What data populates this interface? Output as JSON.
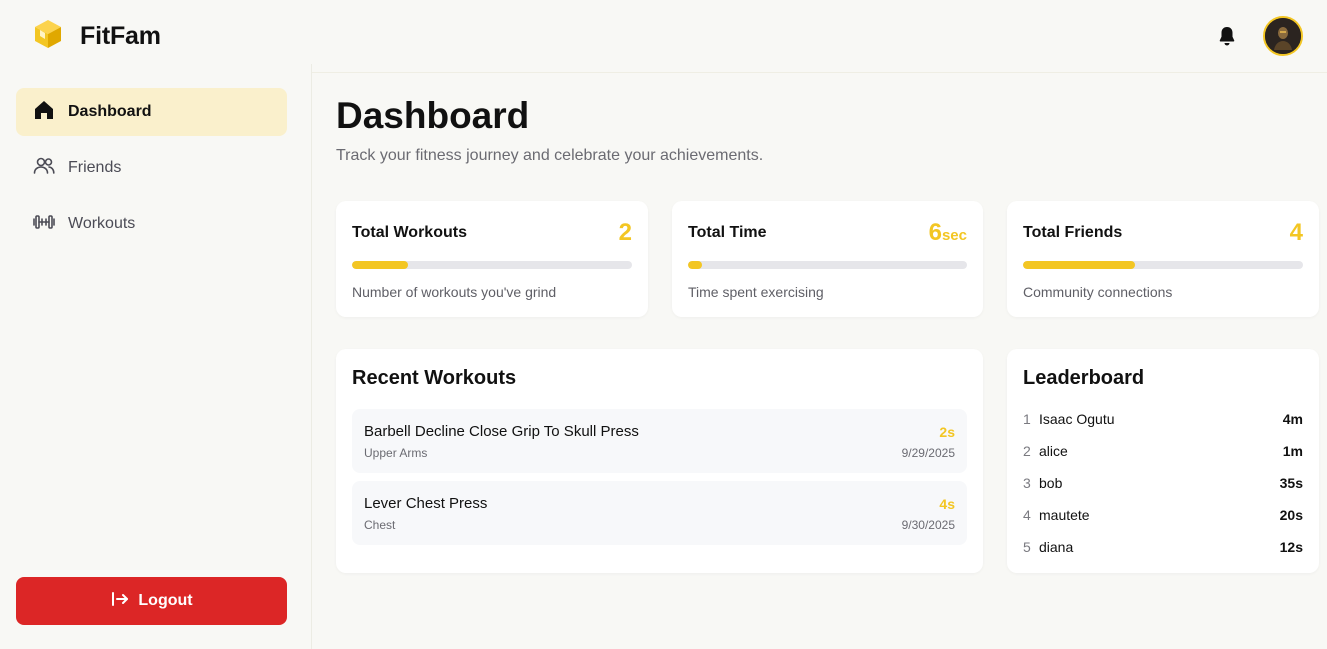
{
  "app": {
    "name": "FitFam"
  },
  "icons": {
    "brand": "cube-icon",
    "bell": "bell-icon",
    "home": "home-icon",
    "friends": "users-icon",
    "workouts": "dumbbell-icon",
    "logout": "logout-icon"
  },
  "colors": {
    "accent": "#f3c623",
    "logout": "#dc2626",
    "active_nav_bg": "#faf0cc"
  },
  "sidebar": {
    "items": [
      {
        "label": "Dashboard",
        "active": true
      },
      {
        "label": "Friends",
        "active": false
      },
      {
        "label": "Workouts",
        "active": false
      }
    ],
    "logout_label": "Logout"
  },
  "main": {
    "title": "Dashboard",
    "subtitle": "Track your fitness journey and celebrate your achievements."
  },
  "stats": [
    {
      "title": "Total Workouts",
      "value": "2",
      "unit": "",
      "progress": 0.2,
      "description": "Number of workouts you've grind"
    },
    {
      "title": "Total Time",
      "value": "6",
      "unit": "sec",
      "progress": 0.05,
      "description": "Time spent exercising"
    },
    {
      "title": "Total Friends",
      "value": "4",
      "unit": "",
      "progress": 0.4,
      "description": "Community connections"
    }
  ],
  "recent_workouts": {
    "title": "Recent Workouts",
    "items": [
      {
        "name": "Barbell Decline Close Grip To Skull Press",
        "category": "Upper Arms",
        "duration": "2s",
        "date": "9/29/2025"
      },
      {
        "name": "Lever Chest Press",
        "category": "Chest",
        "duration": "4s",
        "date": "9/30/2025"
      }
    ]
  },
  "leaderboard": {
    "title": "Leaderboard",
    "rows": [
      {
        "rank": "1",
        "name": "Isaac Ogutu",
        "score": "4m"
      },
      {
        "rank": "2",
        "name": "alice",
        "score": "1m"
      },
      {
        "rank": "3",
        "name": "bob",
        "score": "35s"
      },
      {
        "rank": "4",
        "name": "mautete",
        "score": "20s"
      },
      {
        "rank": "5",
        "name": "diana",
        "score": "12s"
      }
    ]
  }
}
